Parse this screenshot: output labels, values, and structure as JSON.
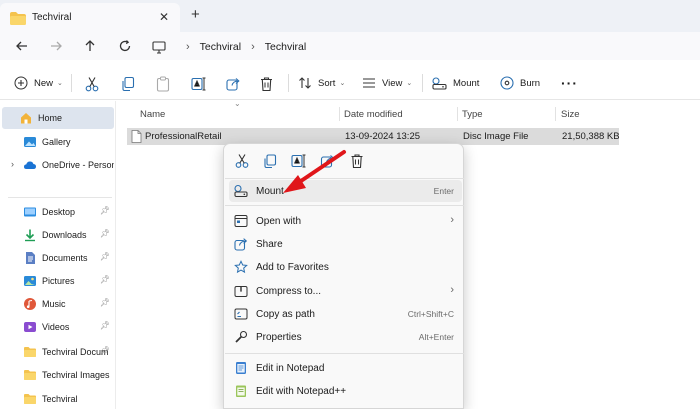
{
  "tab": {
    "title": "Techviral"
  },
  "breadcrumb": [
    "Techviral",
    "Techviral"
  ],
  "toolbar": {
    "new_label": "New",
    "sort_label": "Sort",
    "view_label": "View",
    "mount_label": "Mount",
    "burn_label": "Burn"
  },
  "sidebar": {
    "items": [
      {
        "label": "Home"
      },
      {
        "label": "Gallery"
      },
      {
        "label": "OneDrive - Persona"
      },
      {
        "label": "Desktop"
      },
      {
        "label": "Downloads"
      },
      {
        "label": "Documents"
      },
      {
        "label": "Pictures"
      },
      {
        "label": "Music"
      },
      {
        "label": "Videos"
      },
      {
        "label": "Techviral Docum"
      },
      {
        "label": "Techviral Images"
      },
      {
        "label": "Techviral"
      }
    ]
  },
  "columns": {
    "name": "Name",
    "date": "Date modified",
    "type": "Type",
    "size": "Size"
  },
  "file": {
    "name": "ProfessionalRetail",
    "date": "13-09-2024 13:25",
    "type": "Disc Image File",
    "size": "21,50,388 KB"
  },
  "context_menu": {
    "items": [
      {
        "label": "Mount",
        "shortcut": "Enter"
      },
      {
        "label": "Open with",
        "shortcut": ""
      },
      {
        "label": "Share",
        "shortcut": ""
      },
      {
        "label": "Add to Favorites",
        "shortcut": ""
      },
      {
        "label": "Compress to...",
        "shortcut": ""
      },
      {
        "label": "Copy as path",
        "shortcut": "Ctrl+Shift+C"
      },
      {
        "label": "Properties",
        "shortcut": "Alt+Enter"
      },
      {
        "label": "Edit in Notepad",
        "shortcut": ""
      },
      {
        "label": "Edit with Notepad++",
        "shortcut": ""
      }
    ]
  },
  "colors": {
    "accent": "#0067c0",
    "folder": "#f4c34e",
    "arrow": "#e0161a",
    "selection": "#dbdbdb"
  }
}
